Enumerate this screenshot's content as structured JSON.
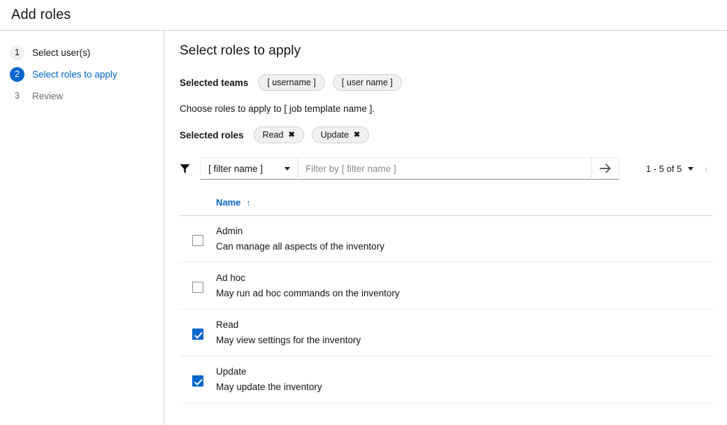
{
  "header": {
    "title": "Add roles"
  },
  "wizard_nav": {
    "steps": [
      {
        "num": "1",
        "label": "Select user(s)",
        "state": "complete"
      },
      {
        "num": "2",
        "label": "Select roles to apply",
        "state": "current"
      },
      {
        "num": "3",
        "label": "Review",
        "state": "pending"
      }
    ]
  },
  "main": {
    "title": "Select roles to apply",
    "selected_teams_label": "Selected teams",
    "selected_teams": [
      {
        "label": "[ username ]"
      },
      {
        "label": "[ user name ]"
      }
    ],
    "helper_text": "Choose roles to apply to [ job template name ].",
    "selected_roles_label": "Selected roles",
    "selected_roles": [
      {
        "label": "Read",
        "remove": "✖"
      },
      {
        "label": "Update",
        "remove": "✖"
      }
    ]
  },
  "toolbar": {
    "filter_icon": "filter-icon",
    "filter_select_value": "[ filter name ]",
    "filter_input_value": "",
    "filter_input_placeholder": "Filter by [ filter name ]",
    "submit_icon": "arrow-right-icon",
    "pagination_text": "1 - 5 of 5",
    "prev_icon": "‹"
  },
  "table": {
    "columns": [
      {
        "label": "Name",
        "sort_arrow": "↑",
        "sorted": true
      }
    ],
    "rows": [
      {
        "name": "Admin",
        "description": "Can manage all aspects of the inventory",
        "checked": false
      },
      {
        "name": "Ad hoc",
        "description": "May run ad hoc commands on the inventory",
        "checked": false
      },
      {
        "name": "Read",
        "description": "May view settings for the inventory",
        "checked": true
      },
      {
        "name": "Update",
        "description": "May update the inventory",
        "checked": true
      }
    ]
  },
  "colors": {
    "accent": "#0066cc",
    "text": "#151515",
    "muted": "#6a6e73",
    "border": "#d2d2d2",
    "row_border": "#ededed",
    "chip_bg": "#f0f0f0"
  }
}
